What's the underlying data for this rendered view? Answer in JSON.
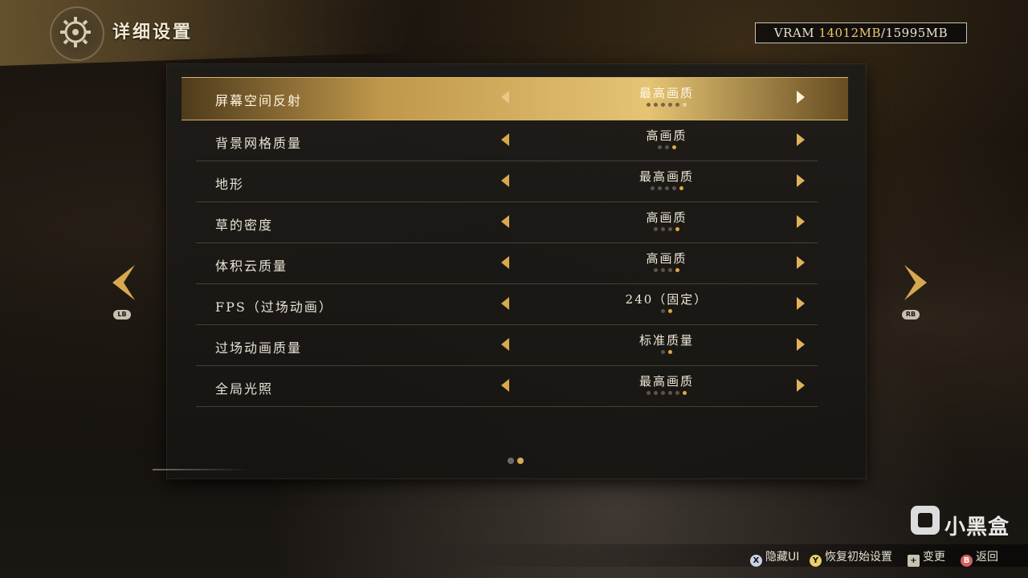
{
  "header": {
    "title": "详细设置"
  },
  "vram": {
    "label": "VRAM",
    "used": "14012",
    "used_unit": "MB",
    "separator": "/",
    "total": "15995MB"
  },
  "settings": [
    {
      "label": "屏幕空间反射",
      "value": "最高画质",
      "levels": 6,
      "selected_level": 6,
      "selected": true
    },
    {
      "label": "背景网格质量",
      "value": "高画质",
      "levels": 3,
      "selected_level": 3
    },
    {
      "label": "地形",
      "value": "最高画质",
      "levels": 5,
      "selected_level": 5
    },
    {
      "label": "草的密度",
      "value": "高画质",
      "levels": 4,
      "selected_level": 4
    },
    {
      "label": "体积云质量",
      "value": "高画质",
      "levels": 4,
      "selected_level": 4
    },
    {
      "label": "FPS（过场动画）",
      "value": "240（固定）",
      "levels": 2,
      "selected_level": 2
    },
    {
      "label": "过场动画质量",
      "value": "标准质量",
      "levels": 2,
      "selected_level": 2
    },
    {
      "label": "全局光照",
      "value": "最高画质",
      "levels": 6,
      "selected_level": 6
    }
  ],
  "pagination": {
    "pages": 2,
    "current": 2
  },
  "nav": {
    "prev_badge": "LB",
    "next_badge": "RB"
  },
  "hints": [
    {
      "button": "X",
      "label": "隐藏UI"
    },
    {
      "button": "Y",
      "label": "恢复初始设置"
    },
    {
      "button": "+",
      "label": "变更"
    },
    {
      "button": "B",
      "label": "返回"
    }
  ],
  "watermark": {
    "text": "小黑盒"
  },
  "colors": {
    "accent_gold": "#e0a93e",
    "panel_bg": "#1e1c19",
    "selected_row": "#d9b46a"
  }
}
